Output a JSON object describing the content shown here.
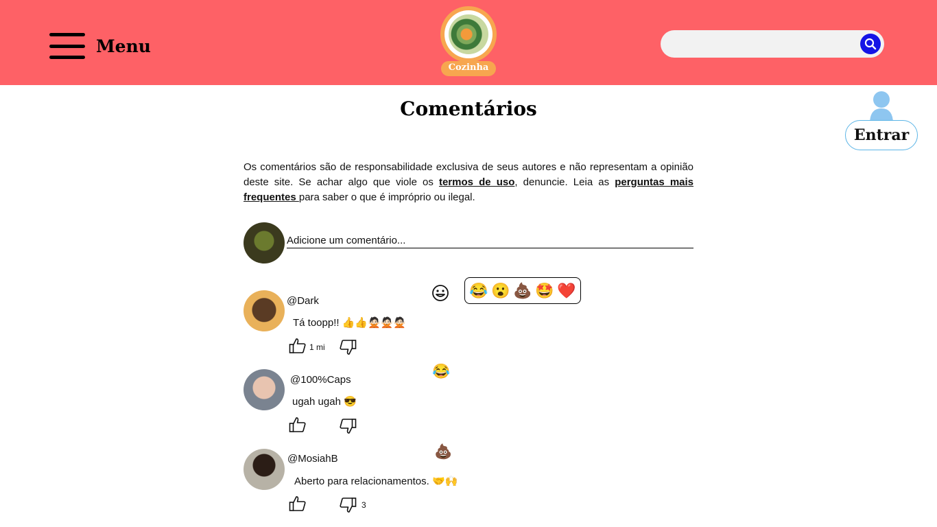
{
  "header": {
    "menu_label": "Menu",
    "logo_text": "Cozinha",
    "search": {
      "placeholder": "",
      "value": ""
    }
  },
  "login": {
    "label": "Entrar"
  },
  "main": {
    "title": "Comentários",
    "disclaimer": {
      "text_1": "Os comentários são de responsabilidade exclusiva de seus autores e não representam a opinião deste site. Se achar algo que viole os ",
      "link_terms": "termos de uso",
      "text_2": ", denuncie. Leia as ",
      "link_faq": "perguntas mais frequentes ",
      "text_3": "para saber o que é impróprio ou ilegal."
    },
    "new_comment": {
      "placeholder": "Adicione um comentário..."
    },
    "reaction_picker": [
      "😂",
      "😮",
      "💩",
      "🤩",
      "❤️"
    ],
    "comments": [
      {
        "username": "@Dark",
        "text": "Tá toopp!!  👍👍🙅🏻🙅🏻🙅🏻",
        "likes": "1 mi",
        "dislikes": "",
        "reaction": ""
      },
      {
        "username": "@100%Caps",
        "text": "ugah ugah 😎",
        "likes": "",
        "dislikes": "",
        "reaction": "😂"
      },
      {
        "username": "@MosiahB",
        "text": "Aberto para relacionamentos. 🤝🙌",
        "likes": "",
        "dislikes": "3",
        "reaction": "💩"
      }
    ]
  },
  "colors": {
    "header_bg": "#fe6166",
    "logo_orange": "#f7a64f",
    "search_button": "#1414e6",
    "login_border": "#5ab4e6",
    "user_icon": "#8ec6f0"
  },
  "icons": {
    "menu": "hamburger-icon",
    "search": "search-icon",
    "user": "user-icon",
    "emoji": "smiley-icon",
    "like": "thumbs-up-icon",
    "dislike": "thumbs-down-icon"
  }
}
